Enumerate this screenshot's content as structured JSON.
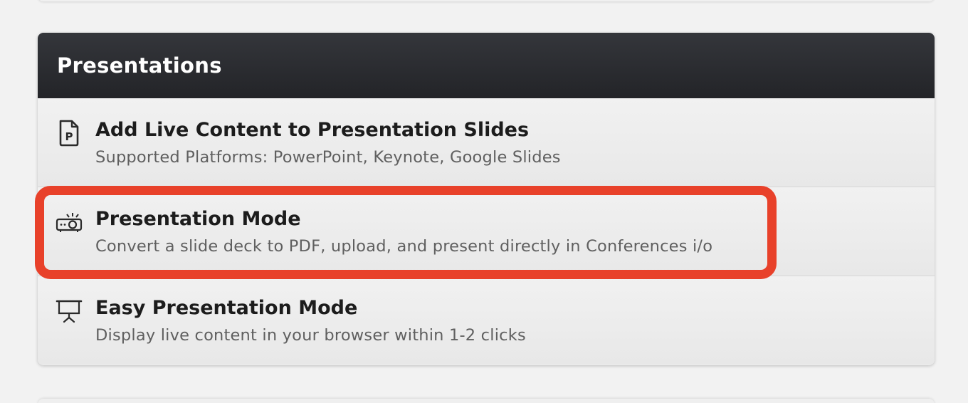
{
  "panel": {
    "title": "Presentations",
    "items": [
      {
        "icon": "powerpoint-file-icon",
        "title": "Add Live Content to Presentation Slides",
        "subtitle": "Supported Platforms: PowerPoint, Keynote, Google Slides"
      },
      {
        "icon": "projector-icon",
        "title": "Presentation Mode",
        "subtitle": "Convert a slide deck to PDF, upload, and present directly in Conferences i/o"
      },
      {
        "icon": "presentation-screen-icon",
        "title": "Easy Presentation Mode",
        "subtitle": "Display live content in your browser within 1-2 clicks"
      }
    ]
  },
  "colors": {
    "header_bg": "#2a2b2f",
    "highlight": "#e8412a"
  }
}
